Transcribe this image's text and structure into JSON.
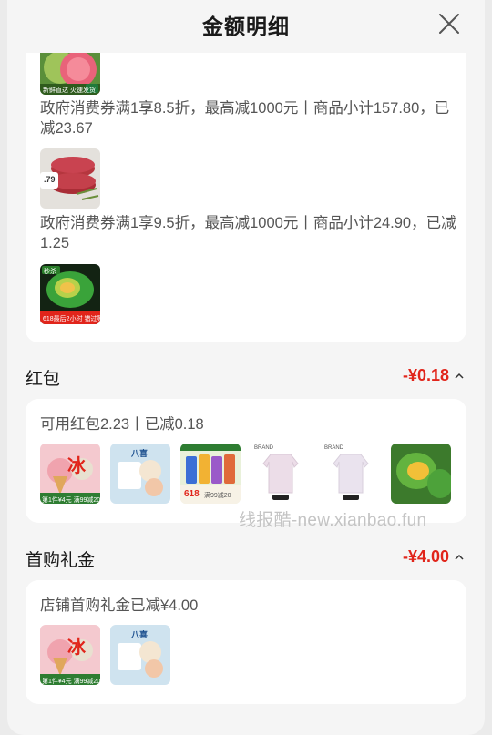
{
  "header": {
    "title": "金额明细"
  },
  "coupon": {
    "items": [
      {
        "desc": "政府消费券满1享8.5折，最高减1000元丨商品小计157.80，已减23.67"
      },
      {
        "desc": "政府消费券满1享9.5折，最高减1000元丨商品小计24.90，已减1.25"
      }
    ],
    "thumb1_tag": "新鲜直达 火速发货",
    "thumb2_price": ".79",
    "thumb3_tag": "618最后2小时 错过等一年",
    "thumb3_badge": "秒杀"
  },
  "redpacket": {
    "title": "红包",
    "amount": "-¥0.18",
    "desc": "可用红包2.23丨已减0.18",
    "thumb_texts": {
      "t1_brand": "冰",
      "t1_tag": "第1件¥4元 满99减20",
      "t2_brand": "八喜",
      "t3_tag": "618",
      "t3_sub": "满99减20",
      "t4_brand": "BRAND",
      "t5_brand": "BRAND"
    }
  },
  "firstgift": {
    "title": "首购礼金",
    "amount": "-¥4.00",
    "desc": "店铺首购礼金已减¥4.00"
  },
  "watermark": "线报酷-new.xianbao.fun",
  "colors": {
    "accent": "#e1251b",
    "card": "#ffffff",
    "bg": "#f5f5f5"
  }
}
